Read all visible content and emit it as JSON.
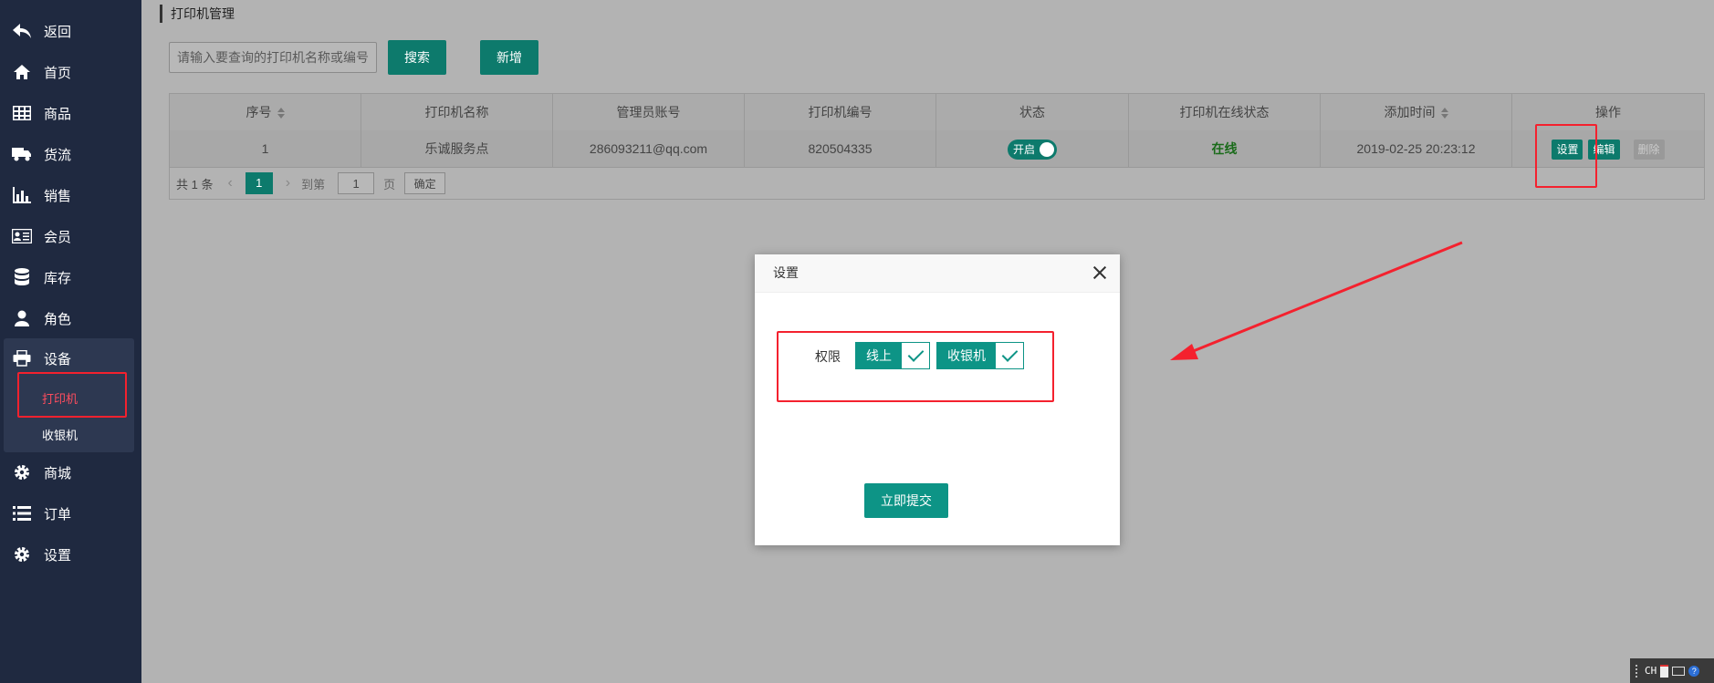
{
  "sidebar": {
    "items": [
      {
        "label": "返回",
        "icon": "back-arrow-icon"
      },
      {
        "label": "首页",
        "icon": "home-icon"
      },
      {
        "label": "商品",
        "icon": "grid-table-icon"
      },
      {
        "label": "货流",
        "icon": "truck-icon"
      },
      {
        "label": "销售",
        "icon": "bar-chart-icon"
      },
      {
        "label": "会员",
        "icon": "id-card-icon"
      },
      {
        "label": "库存",
        "icon": "database-icon"
      },
      {
        "label": "角色",
        "icon": "user-icon"
      },
      {
        "label": "设备",
        "icon": "printer-icon"
      },
      {
        "label": "商城",
        "icon": "gear-icon"
      },
      {
        "label": "订单",
        "icon": "list-icon"
      },
      {
        "label": "设置",
        "icon": "gear-icon"
      }
    ],
    "submenu": [
      {
        "label": "打印机",
        "active": true
      },
      {
        "label": "收银机",
        "active": false
      }
    ]
  },
  "header": {
    "breadcrumb": "打印机管理"
  },
  "toolbar": {
    "search_placeholder": "请输入要查询的打印机名称或编号",
    "search_label": "搜索",
    "add_label": "新增"
  },
  "table": {
    "columns": [
      "序号",
      "打印机名称",
      "管理员账号",
      "打印机编号",
      "状态",
      "打印机在线状态",
      "添加时间",
      "操作"
    ],
    "rows": [
      {
        "index": "1",
        "name": "乐诚服务点",
        "admin": "286093211@qq.com",
        "number": "820504335",
        "status": "开启",
        "online": "在线",
        "added": "2019-02-25 20:23:12",
        "actions": [
          "设置",
          "编辑",
          "删除"
        ]
      }
    ]
  },
  "pager": {
    "total": "共 1 条",
    "current_page": "1",
    "goto_label": "到第",
    "goto_value": "1",
    "page_unit": "页",
    "confirm_label": "确定"
  },
  "modal": {
    "title": "设置",
    "permission_label": "权限",
    "options": [
      {
        "label": "线上",
        "checked": true
      },
      {
        "label": "收银机",
        "checked": true
      }
    ],
    "submit_label": "立即提交"
  },
  "tray": {
    "lang": "CH"
  },
  "colors": {
    "accent": "#0d7a6c",
    "sidebar_bg": "#1f2940",
    "annotation_red": "#f4212e",
    "online_green": "#1a6b1a"
  }
}
